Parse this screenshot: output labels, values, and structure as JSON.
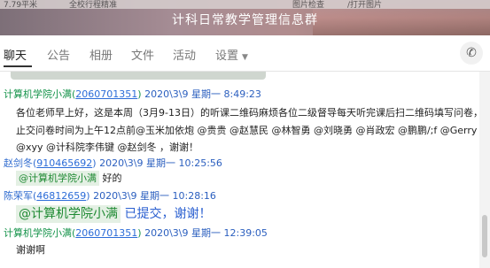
{
  "window": {
    "title": "计科日常教学管理信息群",
    "strip_texts": [
      "7.79平米",
      "全校行程精准",
      "图片检查",
      "/打开图片"
    ]
  },
  "tabs": [
    {
      "label": "聊天",
      "active": true
    },
    {
      "label": "公告"
    },
    {
      "label": "相册"
    },
    {
      "label": "文件"
    },
    {
      "label": "活动"
    },
    {
      "label": "设置",
      "has_dropdown": true
    }
  ],
  "messages": [
    {
      "sender": "计算机学院小满",
      "qq": "2060701351",
      "time": "2020\\3\\9 星期一 8:49:23",
      "lines": [
        "各位老师早上好，这是本周（3月9-13日）的听课二维码麻烦各位二级督导每天听完课后扫二维码填写问卷，截",
        "止交问卷时间为上午12点前@玉米加依炮 @贵贵 @赵慧民 @林智勇 @刘晓勇 @肖政宏 @鹏鹏/;f @Gerry",
        "@xyy @计科院李伟键 @赵剑冬 ，谢谢！"
      ]
    },
    {
      "sender": "赵剑冬",
      "qq": "910465692",
      "time": "2020\\3\\9 星期一 10:25:56",
      "mention": "@计算机学院小满",
      "text": "好的"
    },
    {
      "sender": "陈荣军",
      "qq": "46812659",
      "time": "2020\\3\\9 星期一 10:28:16",
      "mention": "@计算机学院小满",
      "text": "已提交，谢谢！"
    },
    {
      "sender": "计算机学院小满",
      "qq": "2060701351",
      "time": "2020\\3\\9 星期一 12:39:05",
      "text": "谢谢啊"
    }
  ],
  "icons": {
    "call": "phone-icon"
  }
}
